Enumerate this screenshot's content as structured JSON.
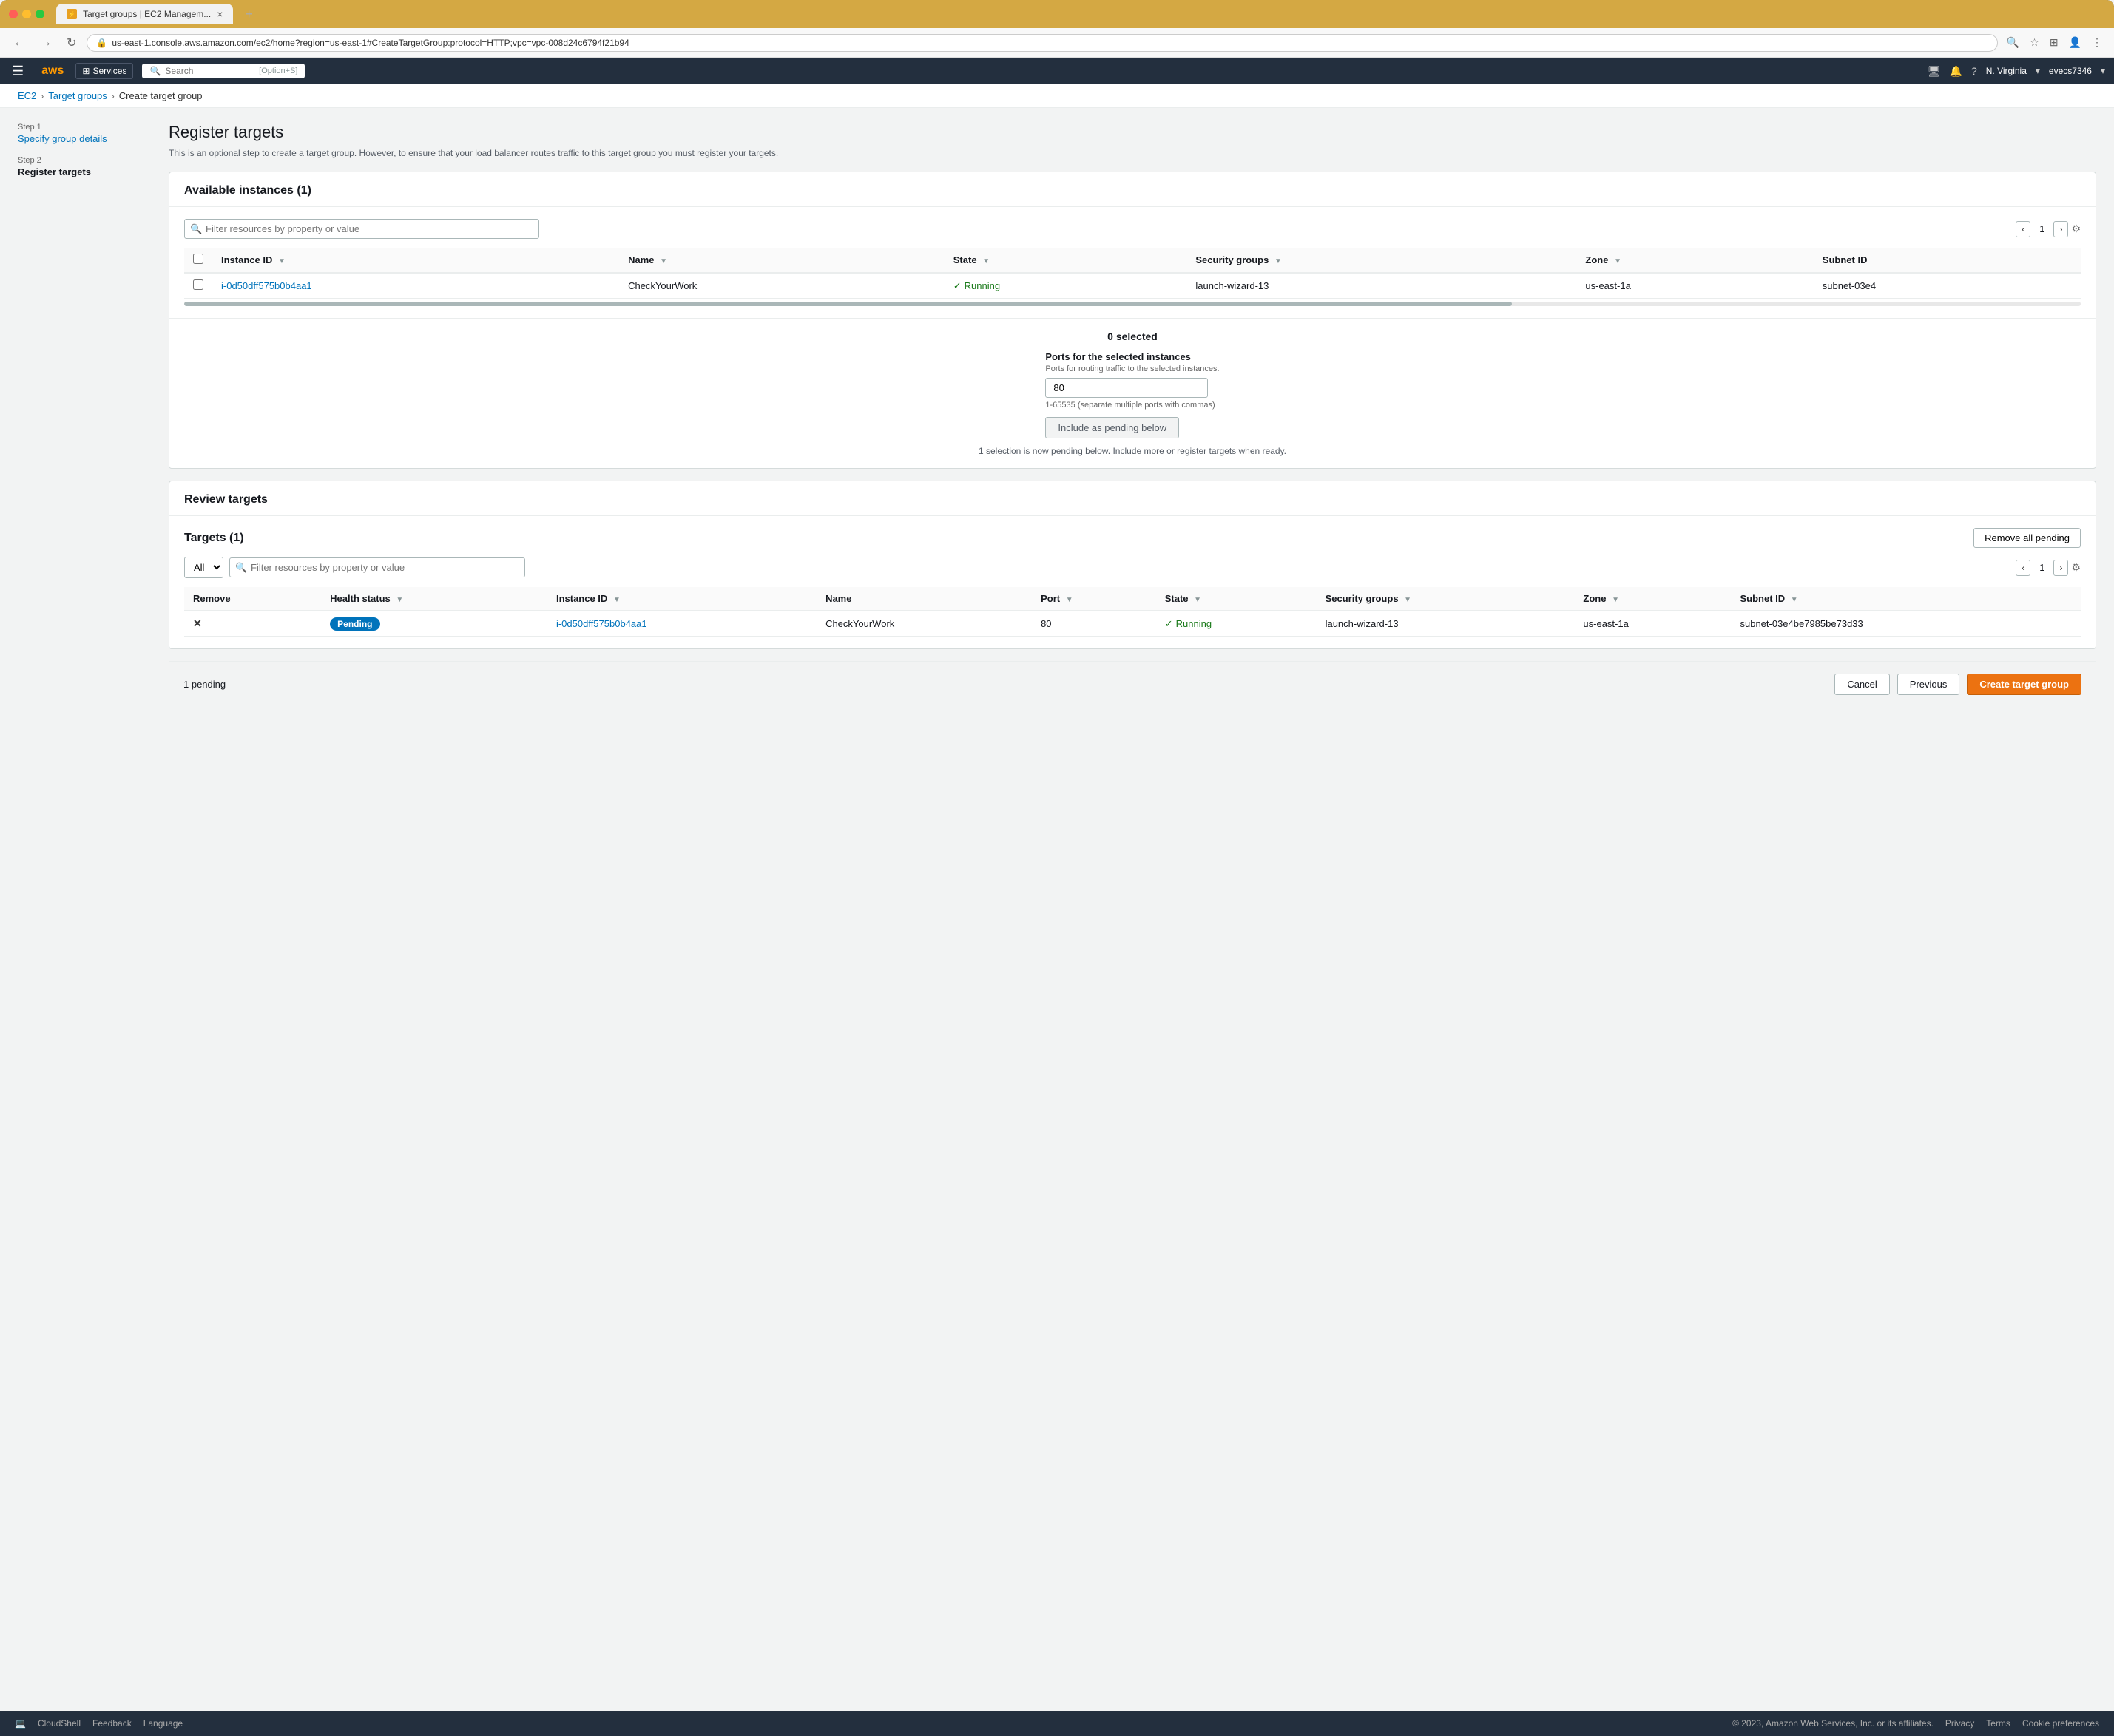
{
  "browser": {
    "tab_title": "Target groups | EC2 Managem...",
    "tab_close": "×",
    "tab_new": "+",
    "address": "us-east-1.console.aws.amazon.com/ec2/home?region=us-east-1#CreateTargetGroup:protocol=HTTP;vpc=vpc-008d24c6794f21b94",
    "nav_back": "←",
    "nav_forward": "→",
    "nav_reload": "↻",
    "chevron_down": "⌄"
  },
  "aws_header": {
    "logo": "aws",
    "services_label": "Services",
    "search_placeholder": "Search",
    "search_shortcut": "[Option+S]",
    "region": "N. Virginia",
    "user": "evecs7346",
    "icons": [
      "monitor-icon",
      "bell-icon",
      "help-icon"
    ]
  },
  "breadcrumb": {
    "items": [
      {
        "label": "EC2",
        "link": true
      },
      {
        "label": "Target groups",
        "link": true
      },
      {
        "label": "Create target group",
        "link": false
      }
    ]
  },
  "sidebar": {
    "steps": [
      {
        "step": "Step 1",
        "name": "Specify group details",
        "state": "active"
      },
      {
        "step": "Step 2",
        "name": "Register targets",
        "state": "current"
      }
    ]
  },
  "page": {
    "title": "Register targets",
    "description": "This is an optional step to create a target group. However, to ensure that your load balancer routes traffic to this target group you must register your targets."
  },
  "available_instances": {
    "title": "Available instances",
    "count": 1,
    "filter_placeholder": "Filter resources by property or value",
    "pagination": {
      "page": "1"
    },
    "columns": [
      {
        "id": "instance_id",
        "label": "Instance ID"
      },
      {
        "id": "name",
        "label": "Name"
      },
      {
        "id": "state",
        "label": "State"
      },
      {
        "id": "security_groups",
        "label": "Security groups"
      },
      {
        "id": "zone",
        "label": "Zone"
      },
      {
        "id": "subnet_id",
        "label": "Subnet ID"
      }
    ],
    "rows": [
      {
        "instance_id": "i-0d50dff575b0b4aa1",
        "name": "CheckYourWork",
        "state": "Running",
        "security_groups": "launch-wizard-13",
        "zone": "us-east-1a",
        "subnet_id": "subnet-03e4"
      }
    ]
  },
  "selected_section": {
    "selected_label": "0 selected",
    "ports_label": "Ports for the selected instances",
    "ports_sublabel": "Ports for routing traffic to the selected instances.",
    "ports_value": "80",
    "ports_hint": "1-65535 (separate multiple ports with commas)",
    "include_btn_label": "Include as pending below",
    "pending_msg": "1 selection is now pending below. Include more or register targets when ready."
  },
  "review_targets": {
    "title": "Review targets",
    "targets_label": "Targets",
    "targets_count": 1,
    "remove_all_btn": "Remove all pending",
    "filter_placeholder": "Filter resources by property or value",
    "filter_option": "All",
    "pagination": {
      "page": "1"
    },
    "columns": [
      {
        "id": "remove",
        "label": "Remove"
      },
      {
        "id": "health_status",
        "label": "Health status"
      },
      {
        "id": "instance_id",
        "label": "Instance ID"
      },
      {
        "id": "name",
        "label": "Name"
      },
      {
        "id": "port",
        "label": "Port"
      },
      {
        "id": "state",
        "label": "State"
      },
      {
        "id": "security_groups",
        "label": "Security groups"
      },
      {
        "id": "zone",
        "label": "Zone"
      },
      {
        "id": "subnet_id",
        "label": "Subnet ID"
      }
    ],
    "rows": [
      {
        "health_status": "Pending",
        "instance_id": "i-0d50dff575b0b4aa1",
        "name": "CheckYourWork",
        "port": "80",
        "state": "Running",
        "security_groups": "launch-wizard-13",
        "zone": "us-east-1a",
        "subnet_id": "subnet-03e4be7985be73d33"
      }
    ]
  },
  "footer": {
    "pending_count": "1 pending",
    "cancel_label": "Cancel",
    "previous_label": "Previous",
    "create_label": "Create target group"
  },
  "aws_footer": {
    "cloudshell_label": "CloudShell",
    "feedback_label": "Feedback",
    "language_label": "Language",
    "copyright": "© 2023, Amazon Web Services, Inc. or its affiliates.",
    "links": [
      "Privacy",
      "Terms",
      "Cookie preferences"
    ]
  }
}
